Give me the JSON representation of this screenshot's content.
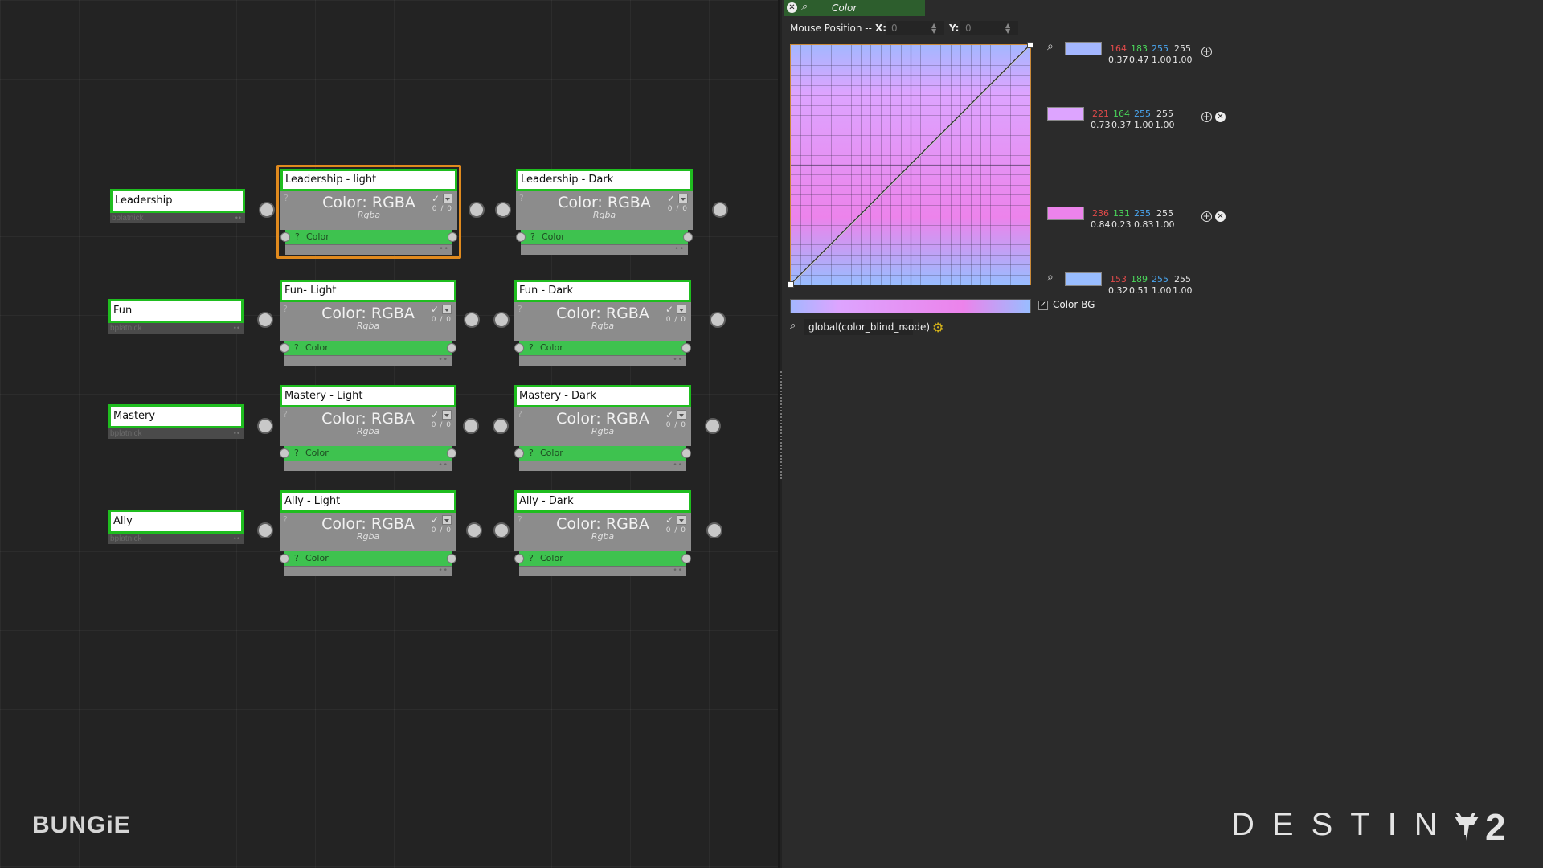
{
  "graph": {
    "rows": [
      {
        "label": "Leadership",
        "owner": "bplatnick",
        "light": {
          "title": "Leadership - light",
          "selected": true
        },
        "dark": {
          "title": "Leadership - Dark"
        }
      },
      {
        "label": "Fun",
        "owner": "bplatnick",
        "light": {
          "title": "Fun- Light",
          "selected": false
        },
        "dark": {
          "title": "Fun - Dark"
        }
      },
      {
        "label": "Mastery",
        "owner": "bplatnick",
        "light": {
          "title": "Mastery - Light",
          "selected": false
        },
        "dark": {
          "title": "Mastery - Dark"
        }
      },
      {
        "label": "Ally",
        "owner": "bplatnick",
        "light": {
          "title": "Ally - Light",
          "selected": false
        },
        "dark": {
          "title": "Ally - Dark"
        }
      }
    ],
    "node_main": "Color: RGBA",
    "node_sub": "Rgba",
    "node_port": "Color",
    "node_counter": "0 / 0",
    "node_q": "?"
  },
  "panel": {
    "tab_title": "Color",
    "mouse_label": "Mouse Position --",
    "x_label": "X:",
    "x_value": "0",
    "y_label": "Y:",
    "y_value": "0",
    "stops": [
      {
        "r": "164",
        "g": "183",
        "b": "255",
        "a": "255",
        "rf": "0.37",
        "gf": "0.47",
        "bf": "1.00",
        "af": "1.00",
        "color": "#a4b7ff"
      },
      {
        "r": "221",
        "g": "164",
        "b": "255",
        "a": "255",
        "rf": "0.73",
        "gf": "0.37",
        "bf": "1.00",
        "af": "1.00",
        "color": "#dda4ff"
      },
      {
        "r": "236",
        "g": "131",
        "b": "235",
        "a": "255",
        "rf": "0.84",
        "gf": "0.23",
        "bf": "0.83",
        "af": "1.00",
        "color": "#ec83eb"
      },
      {
        "r": "153",
        "g": "189",
        "b": "255",
        "a": "255",
        "rf": "0.32",
        "gf": "0.51",
        "bf": "1.00",
        "af": "1.00",
        "color": "#99bdff"
      }
    ],
    "color_bg_label": "Color BG",
    "color_bg_checked": true,
    "mode_select": "global(color_blind_mode)"
  },
  "branding": {
    "bungie": "BUNGiE",
    "destiny": "DESTINY",
    "destiny_num": "2"
  },
  "colors": {
    "accent_green": "#1fbd1f",
    "port_green": "#3ec24f",
    "selected_orange": "#e08a1e",
    "panel_tab": "#2d5e2d"
  }
}
